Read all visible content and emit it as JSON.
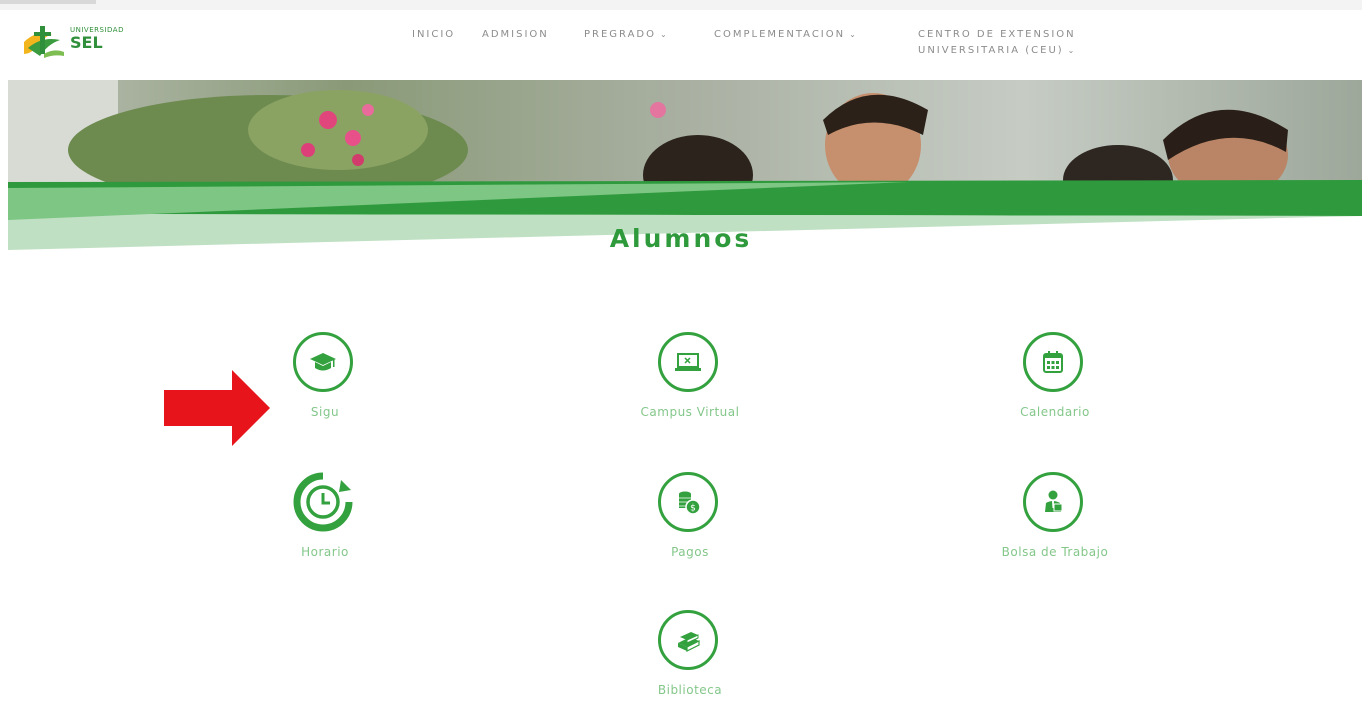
{
  "header": {
    "logo": {
      "small_text": "UNIVERSIDAD",
      "big_text": "SEL"
    },
    "nav": {
      "inicio": "INICIO",
      "admision": "ADMISION",
      "pregrado": "PREGRADO",
      "complementacion": "COMPLEMENTACION",
      "centro_line1": "CENTRO DE EXTENSION",
      "centro_line2": "UNIVERSITARIA (CEU)"
    }
  },
  "page": {
    "title": "Alumnos"
  },
  "tiles": {
    "sigu": {
      "label": "Sigu",
      "icon": "graduation-cap-icon"
    },
    "campus": {
      "label": "Campus Virtual",
      "icon": "laptop-icon"
    },
    "calendario": {
      "label": "Calendario",
      "icon": "calendar-icon"
    },
    "horario": {
      "label": "Horario",
      "icon": "clock-icon"
    },
    "pagos": {
      "label": "Pagos",
      "icon": "coins-icon"
    },
    "bolsa": {
      "label": "Bolsa de Trabajo",
      "icon": "businessman-icon"
    },
    "biblioteca": {
      "label": "Biblioteca",
      "icon": "book-icon"
    }
  },
  "colors": {
    "brand_green": "#34a13f",
    "label_green": "#84c78a",
    "arrow_red": "#e8141b"
  }
}
